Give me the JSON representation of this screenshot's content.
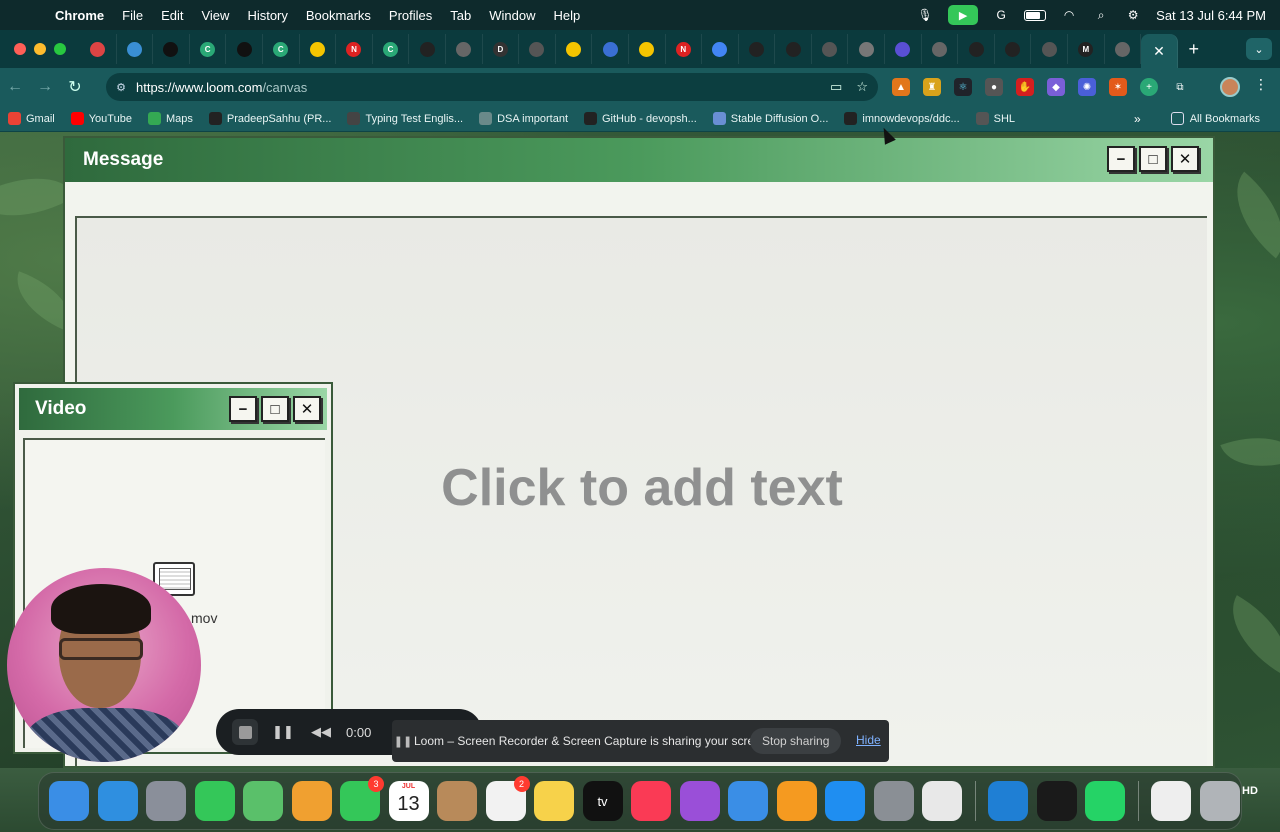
{
  "menubar": {
    "app_name": "Chrome",
    "items": [
      "File",
      "Edit",
      "View",
      "History",
      "Bookmarks",
      "Profiles",
      "Tab",
      "Window",
      "Help"
    ],
    "clock": "Sat 13 Jul  6:44 PM"
  },
  "tabs": {
    "favicons": [
      {
        "icon": "record-icon",
        "color": "#d44"
      },
      {
        "icon": "loom-icon",
        "color": "#3a8fd4"
      },
      {
        "icon": "medium-icon",
        "color": "#111"
      },
      {
        "icon": "c-icon",
        "color": "#2aa876"
      },
      {
        "icon": "medium-icon",
        "color": "#111"
      },
      {
        "icon": "c-icon",
        "color": "#2aa876"
      },
      {
        "icon": "warning-icon",
        "color": "#f5c400"
      },
      {
        "icon": "n-icon",
        "color": "#d22"
      },
      {
        "icon": "c-icon",
        "color": "#2aa876"
      },
      {
        "icon": "github-icon",
        "color": "#222"
      },
      {
        "icon": "chrome-icon",
        "color": "#666"
      },
      {
        "icon": "d-icon",
        "color": "#333"
      },
      {
        "icon": "openai-icon",
        "color": "#555"
      },
      {
        "icon": "warning-icon",
        "color": "#f5c400"
      },
      {
        "icon": "bulb-icon",
        "color": "#3a6fd4"
      },
      {
        "icon": "warning-icon",
        "color": "#f5c400"
      },
      {
        "icon": "n-icon",
        "color": "#d22"
      },
      {
        "icon": "google-icon",
        "color": "#4285f4"
      },
      {
        "icon": "github-icon",
        "color": "#222"
      },
      {
        "icon": "github-icon",
        "color": "#222"
      },
      {
        "icon": "openai-icon",
        "color": "#555"
      },
      {
        "icon": "globe-icon",
        "color": "#777"
      },
      {
        "icon": "star-icon",
        "color": "#5a4fd4"
      },
      {
        "icon": "chrome-icon",
        "color": "#666"
      },
      {
        "icon": "github-icon",
        "color": "#222"
      },
      {
        "icon": "github-icon",
        "color": "#222"
      },
      {
        "icon": "openai-icon",
        "color": "#555"
      },
      {
        "icon": "m-icon",
        "color": "#222"
      },
      {
        "icon": "chrome-icon",
        "color": "#666"
      }
    ],
    "favicon_letters": {
      "d": "D",
      "m": "M",
      "n": "N",
      "c": "C"
    },
    "active_close": "✕",
    "new_tab": "+"
  },
  "toolbar": {
    "url_host": "https://www.loom.com",
    "url_path": "/canvas"
  },
  "bookmarks": {
    "items": [
      {
        "icon": "gmail-icon",
        "color": "#ea4335",
        "label": "Gmail"
      },
      {
        "icon": "youtube-icon",
        "color": "#ff0000",
        "label": "YouTube"
      },
      {
        "icon": "maps-icon",
        "color": "#34a853",
        "label": "Maps"
      },
      {
        "icon": "github-icon",
        "color": "#222",
        "label": "PradeepSahhu (PR..."
      },
      {
        "icon": "typing-icon",
        "color": "#444",
        "label": "Typing Test Englis..."
      },
      {
        "icon": "folder-icon",
        "color": "#6a8a8a",
        "label": "DSA important"
      },
      {
        "icon": "github-icon",
        "color": "#222",
        "label": "GitHub - devopsh..."
      },
      {
        "icon": "stable-diffusion-icon",
        "color": "#6a8fd4",
        "label": "Stable Diffusion O..."
      },
      {
        "icon": "github-icon",
        "color": "#222",
        "label": "imnowdevops/ddc..."
      },
      {
        "icon": "shl-icon",
        "color": "#555",
        "label": "SHL"
      }
    ],
    "all_bookmarks": "All Bookmarks"
  },
  "message_window": {
    "title": "Message",
    "placeholder": "Click to add text"
  },
  "video_window": {
    "title": "Video",
    "file_name": "mov"
  },
  "window_controls": {
    "minimize": "−",
    "maximize": "□",
    "close": "✕"
  },
  "recorder": {
    "time": "0:00"
  },
  "share_notice": {
    "message": "Loom – Screen Recorder & Screen Capture is sharing your screen.",
    "stop_label": "Stop sharing",
    "hide_label": "Hide"
  },
  "dock": {
    "apps": [
      {
        "icon": "finder-icon",
        "color": "#3a8ee6"
      },
      {
        "icon": "safari-icon",
        "color": "#2f8fe0"
      },
      {
        "icon": "launchpad-icon",
        "color": "#8a8f9a"
      },
      {
        "icon": "messages-icon",
        "color": "#34c759"
      },
      {
        "icon": "maps-app-icon",
        "color": "#5ac06a"
      },
      {
        "icon": "photos-icon",
        "color": "#f0a030"
      },
      {
        "icon": "facetime-icon",
        "color": "#34c759",
        "badge": "3"
      },
      {
        "icon": "calendar-icon",
        "color": "#ffffff",
        "month": "JUL",
        "day": "13"
      },
      {
        "icon": "contacts-icon",
        "color": "#b88a5a"
      },
      {
        "icon": "reminders-icon",
        "color": "#f2f2f2",
        "badge": "2"
      },
      {
        "icon": "notes-icon",
        "color": "#f7d24a"
      },
      {
        "icon": "appletv-icon",
        "color": "#111111",
        "label": "tv"
      },
      {
        "icon": "music-icon",
        "color": "#fa3a55"
      },
      {
        "icon": "podcasts-icon",
        "color": "#9a4fd8"
      },
      {
        "icon": "keynote-icon",
        "color": "#3a8ee6"
      },
      {
        "icon": "pages-icon",
        "color": "#f59a20"
      },
      {
        "icon": "appstore-icon",
        "color": "#1f8ef1"
      },
      {
        "icon": "settings-icon",
        "color": "#8a8f95"
      },
      {
        "icon": "chrome-app-icon",
        "color": "#e8e8e8"
      },
      {
        "icon": "vscode-icon",
        "color": "#1f7fd4"
      },
      {
        "icon": "terminal-icon",
        "color": "#1a1a1a"
      },
      {
        "icon": "whatsapp-icon",
        "color": "#25d366"
      },
      {
        "icon": "document-icon",
        "color": "#eeeeee"
      },
      {
        "icon": "trash-icon",
        "color": "#b0b4b8"
      }
    ],
    "hd_label": "HD"
  }
}
